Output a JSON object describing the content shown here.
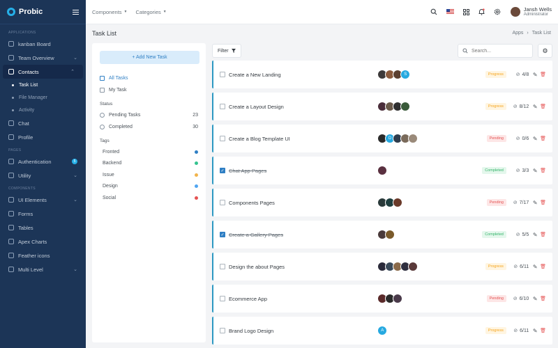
{
  "brand": {
    "name": "Probic"
  },
  "sidebar": {
    "sections": {
      "applications": "APPLICATIONS",
      "pages": "PAGES",
      "components": "COMPONENTS"
    },
    "apps": [
      {
        "label": "kanban Board",
        "icon": "kanban-icon"
      },
      {
        "label": "Team Overview",
        "icon": "team-icon",
        "chevron": "⌄"
      },
      {
        "label": "Contacts",
        "icon": "contacts-icon",
        "chevron": "⌃"
      }
    ],
    "contacts_sub": [
      "Task List",
      "File Manager",
      "Activity"
    ],
    "apps2": [
      {
        "label": "Chat",
        "icon": "chat-icon"
      },
      {
        "label": "Profile",
        "icon": "profile-icon"
      }
    ],
    "pages": [
      {
        "label": "Authentication",
        "icon": "auth-icon",
        "badge": "5"
      },
      {
        "label": "Utility",
        "icon": "utility-icon",
        "chevron": "⌄"
      }
    ],
    "components": [
      {
        "label": "UI Elements",
        "icon": "ui-elements-icon",
        "chevron": "⌄"
      },
      {
        "label": "Forms",
        "icon": "forms-icon"
      },
      {
        "label": "Tables",
        "icon": "tables-icon"
      },
      {
        "label": "Apex Charts",
        "icon": "charts-icon"
      },
      {
        "label": "Feather icons",
        "icon": "feather-icon"
      },
      {
        "label": "Multi Level",
        "icon": "multilevel-icon",
        "chevron": "⌄"
      }
    ]
  },
  "topbar": {
    "menus": [
      "Components",
      "Categories"
    ],
    "user": {
      "name": "Jansh Wells",
      "role": "Administrator"
    }
  },
  "page": {
    "title": "Task List",
    "breadcrumb": [
      "Apps",
      "›",
      "Task List"
    ]
  },
  "left_panel": {
    "add_task": "+ Add New Task",
    "filters": [
      {
        "label": "All Tasks",
        "icon": "folder-icon"
      },
      {
        "label": "My Task",
        "icon": "calendar-icon"
      }
    ],
    "status_heading": "Status",
    "statuses": [
      {
        "label": "Pending Tasks",
        "count": "23"
      },
      {
        "label": "Completed",
        "count": "30"
      }
    ],
    "tags_heading": "Tags",
    "tags": [
      {
        "label": "Fronted",
        "color": "#2f7fc4"
      },
      {
        "label": "Backend",
        "color": "#34c38f"
      },
      {
        "label": "Issue",
        "color": "#f1b44c"
      },
      {
        "label": "Design",
        "color": "#50a5f1"
      },
      {
        "label": "Social",
        "color": "#e55353"
      }
    ]
  },
  "toolbar": {
    "filter_label": "Filter",
    "search_placeholder": "Search..."
  },
  "tasks": [
    {
      "title": "Create a New Landing",
      "checked": false,
      "status": "Progress",
      "subtasks": "4/8",
      "avatars": [
        "#3d3a3a",
        "#8a5a3c",
        "#5b4030",
        "S"
      ]
    },
    {
      "title": "Create a Layout Design",
      "checked": false,
      "status": "Progress",
      "subtasks": "8/12",
      "avatars": [
        "#4a2d3a",
        "#6a5a4a",
        "#2f2f2f",
        "#3a5a3a"
      ]
    },
    {
      "title": "Create a Blog Template UI",
      "checked": false,
      "status": "Pending",
      "subtasks": "0/6",
      "avatars": [
        "#2a2a2a",
        "D",
        "#2f3c4c",
        "#7a6a5a",
        "#9a8a7a"
      ]
    },
    {
      "title": "Chat App Pages",
      "checked": true,
      "status": "Completed",
      "subtasks": "3/3",
      "avatars": [
        "#5a3040"
      ]
    },
    {
      "title": "Components Pages",
      "checked": false,
      "status": "Pending",
      "subtasks": "7/17",
      "avatars": [
        "#2a3a3a",
        "#1e3e3e",
        "#6a3a2a"
      ]
    },
    {
      "title": "Create a Gallery Pages",
      "checked": true,
      "status": "Completed",
      "subtasks": "5/5",
      "avatars": [
        "#4a3a3a",
        "#7a5a2a"
      ]
    },
    {
      "title": "Design the about Pages",
      "checked": false,
      "status": "Progress",
      "subtasks": "6/11",
      "avatars": [
        "#2a2a3a",
        "#3a4a5a",
        "#8a6a4a",
        "#2f2f3f",
        "#5a3a3a"
      ]
    },
    {
      "title": "Ecommerce App",
      "checked": false,
      "status": "Pending",
      "subtasks": "6/10",
      "avatars": [
        "#5a2a2a",
        "#2a2a2a",
        "#4a3a4a"
      ]
    },
    {
      "title": "Brand Logo Design",
      "checked": false,
      "status": "Progress",
      "subtasks": "6/11",
      "avatars": [
        "A"
      ]
    }
  ],
  "colors": {
    "sidebar": "#1c3557",
    "accent": "#2f7fc4",
    "task_border": "#2c98c2"
  }
}
